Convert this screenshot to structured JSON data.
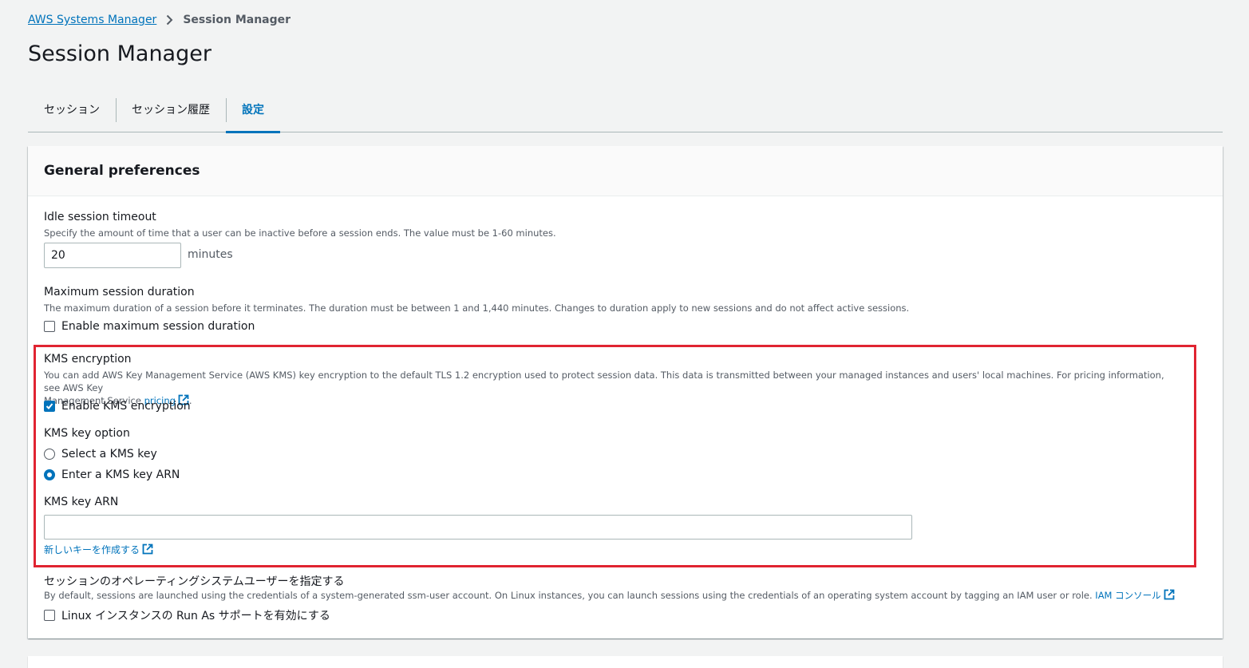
{
  "breadcrumb": {
    "root": "AWS Systems Manager",
    "current": "Session Manager"
  },
  "page": {
    "title": "Session Manager"
  },
  "tabs": [
    {
      "label": "セッション"
    },
    {
      "label": "セッション履歴"
    },
    {
      "label": "設定"
    }
  ],
  "panel": {
    "title": "General preferences",
    "idle": {
      "label": "Idle session timeout",
      "desc": "Specify the amount of time that a user can be inactive before a session ends. The value must be 1-60 minutes.",
      "value": "20",
      "unit": "minutes"
    },
    "max": {
      "label": "Maximum session duration",
      "desc": "The maximum duration of a session before it terminates. The duration must be between 1 and 1,440 minutes. Changes to duration apply to new sessions and do not affect active sessions.",
      "checkbox": "Enable maximum session duration"
    },
    "kms": {
      "label": "KMS encryption",
      "desc1": "You can add AWS Key Management Service (AWS KMS) key encryption to the default TLS 1.2 encryption used to protect session data. This data is transmitted between your managed instances and users' local machines. For pricing information, see AWS Key",
      "desc2": "Management Service ",
      "pricing_link": "pricing",
      "desc_end": ".",
      "checkbox": "Enable KMS encryption",
      "option_label": "KMS key option",
      "option_select": "Select a KMS key",
      "option_enter": "Enter a KMS key ARN",
      "arn_label": "KMS key ARN",
      "arn_value": "",
      "create_link": "新しいキーを作成する"
    },
    "runas": {
      "label": "セッションのオペレーティングシステムユーザーを指定する",
      "desc": "By default, sessions are launched using the credentials of a system-generated ssm-user account. On Linux instances, you can launch sessions using the credentials of an operating system account by tagging an IAM user or role. ",
      "iam_link": "IAM コンソール",
      "checkbox": "Linux インスタンスの Run As サポートを有効にする"
    }
  },
  "colors": {
    "accent": "#0073bb",
    "highlight": "#e02431"
  }
}
